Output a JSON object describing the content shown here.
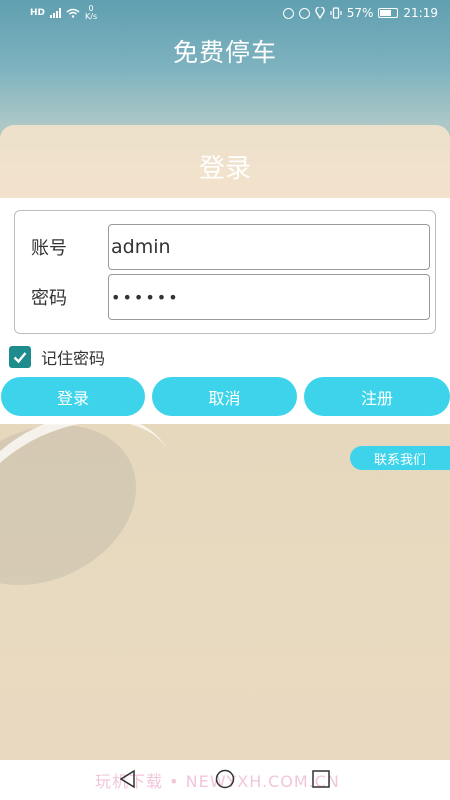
{
  "status_bar": {
    "network": "HD",
    "net_speed_value": "0",
    "net_speed_unit": "K/s",
    "battery": "57%",
    "time": "21:19"
  },
  "app": {
    "title": "免费停车"
  },
  "login": {
    "title": "登录",
    "account_label": "账号",
    "account_value": "admin",
    "password_label": "密码",
    "password_value": "••••••",
    "remember_label": "记住密码",
    "remember_checked": true
  },
  "buttons": {
    "login": "登录",
    "cancel": "取消",
    "register": "注册",
    "contact": "联系我们"
  },
  "watermark": "玩机下载 • NEWYXH.COM.CN",
  "colors": {
    "accent": "#3dd3ea",
    "checkbox": "#1e8c8c"
  }
}
